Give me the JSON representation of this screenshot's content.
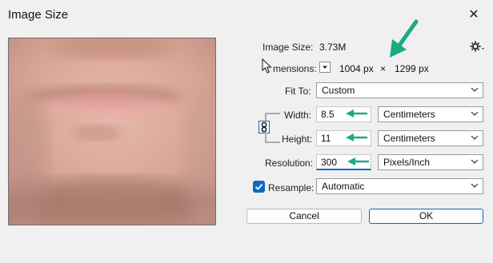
{
  "window": {
    "title": "Image Size"
  },
  "image_size": {
    "label": "Image Size:",
    "value": "3.73M"
  },
  "dimensions": {
    "label": "mensions:",
    "width_value": "1004 px",
    "times": "×",
    "height_value": "1299 px"
  },
  "fit_to": {
    "label": "Fit To:",
    "value": "Custom"
  },
  "width": {
    "label": "Width:",
    "value": "8.5",
    "unit": "Centimeters"
  },
  "height": {
    "label": "Height:",
    "value": "11",
    "unit": "Centimeters"
  },
  "resolution": {
    "label": "Resolution:",
    "value": "300",
    "unit": "Pixels/Inch"
  },
  "resample": {
    "label": "Resample:",
    "checked": true,
    "value": "Automatic"
  },
  "buttons": {
    "cancel": "Cancel",
    "ok": "OK"
  },
  "colors": {
    "accent": "#0c6bbf",
    "annotation_arrow": "#1aaa84",
    "skin": "#d9a89a"
  },
  "icons": {
    "close": "close-icon",
    "settings": "gear-icon",
    "link": "chain-link-icon",
    "dimension_dropdown": "chevron-down-icon",
    "cursor": "mouse-pointer-icon"
  }
}
